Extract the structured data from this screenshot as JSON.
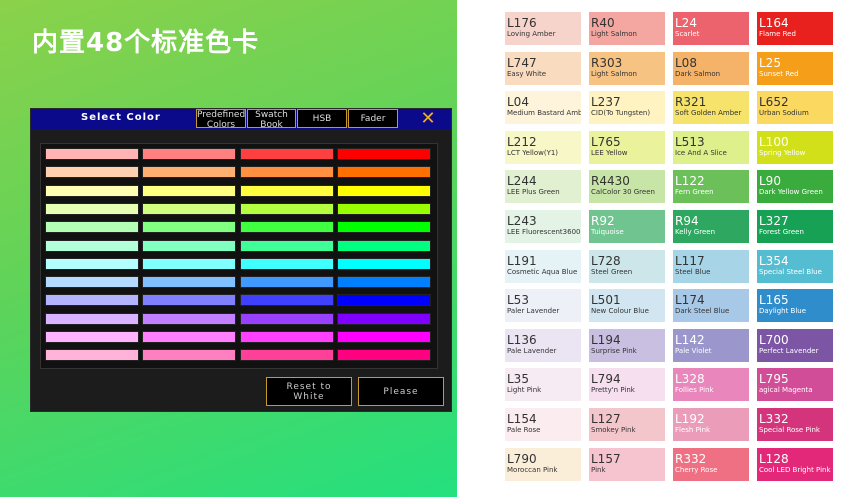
{
  "headline": "内置48个标准色卡",
  "dialog": {
    "title": "Select Color",
    "tabs": [
      {
        "lines": [
          "Predefined",
          "Colors"
        ],
        "active": true
      },
      {
        "lines": [
          "Swatch",
          "Book"
        ],
        "active": false
      },
      {
        "lines": [
          "HSB"
        ],
        "active": false
      },
      {
        "lines": [
          "Fader"
        ],
        "active": false
      }
    ],
    "close_glyph": "✕",
    "swatch_rows": [
      [
        "#ffb3b3",
        "#ff8080",
        "#ff4040",
        "#ff0000"
      ],
      [
        "#ffd0b0",
        "#ffb070",
        "#ff9040",
        "#ff7000"
      ],
      [
        "#ffffb3",
        "#ffff80",
        "#ffff40",
        "#ffff00"
      ],
      [
        "#e6ffb3",
        "#d0ff80",
        "#b3ff40",
        "#99ff00"
      ],
      [
        "#b3ffb3",
        "#80ff80",
        "#40ff40",
        "#00ff00"
      ],
      [
        "#b3ffd9",
        "#80ffc0",
        "#40ff99",
        "#00ff80"
      ],
      [
        "#b3ffff",
        "#80ffff",
        "#40ffff",
        "#00ffff"
      ],
      [
        "#b3d9ff",
        "#80c0ff",
        "#4099ff",
        "#0080ff"
      ],
      [
        "#b3b3ff",
        "#8080ff",
        "#4040ff",
        "#0000ff"
      ],
      [
        "#d9b3ff",
        "#c080ff",
        "#9940ff",
        "#8000ff"
      ],
      [
        "#ffb3ff",
        "#ff80ff",
        "#ff40ff",
        "#ff00ff"
      ],
      [
        "#ffb3d9",
        "#ff80c0",
        "#ff4099",
        "#ff0080"
      ]
    ],
    "buttons": {
      "reset": [
        "Reset to",
        "White"
      ],
      "please": "Please"
    }
  },
  "cards": [
    {
      "code": "L176",
      "name": "Loving Amber",
      "color": "#f6d4cc",
      "text": "#333333"
    },
    {
      "code": "R40",
      "name": "Light Salmon",
      "color": "#f3a7a0",
      "text": "#333333"
    },
    {
      "code": "L24",
      "name": "Scarlet",
      "color": "#ec636d",
      "text": "#ffffff"
    },
    {
      "code": "L164",
      "name": "Flame Red",
      "color": "#e8211f",
      "text": "#ffffff"
    },
    {
      "code": "L747",
      "name": "Easy White",
      "color": "#f9dbc0",
      "text": "#333333"
    },
    {
      "code": "R303",
      "name": "Light Salmon",
      "color": "#f7c383",
      "text": "#333333"
    },
    {
      "code": "L08",
      "name": "Dark Salmon",
      "color": "#f5b36a",
      "text": "#333333"
    },
    {
      "code": "L25",
      "name": "Sunset Red",
      "color": "#f49e1a",
      "text": "#ffffff"
    },
    {
      "code": "L04",
      "name": "Medium Bastard Amber",
      "color": "#fef4dc",
      "text": "#333333"
    },
    {
      "code": "L237",
      "name": "CID(To Tungsten)",
      "color": "#fff3c2",
      "text": "#333333"
    },
    {
      "code": "R321",
      "name": "Soft Golden Amber",
      "color": "#f5e36c",
      "text": "#333333"
    },
    {
      "code": "L652",
      "name": "Urban Sodium",
      "color": "#fbd960",
      "text": "#333333"
    },
    {
      "code": "L212",
      "name": "LCT Yellow(Y1)",
      "color": "#f7f7c8",
      "text": "#333333"
    },
    {
      "code": "L765",
      "name": "LEE Yellow",
      "color": "#ebf29c",
      "text": "#333333"
    },
    {
      "code": "L513",
      "name": "Ice And A Slice",
      "color": "#def08c",
      "text": "#333333"
    },
    {
      "code": "L100",
      "name": "Spring Yellow",
      "color": "#d2e01a",
      "text": "#ffffff"
    },
    {
      "code": "L244",
      "name": "LEE Plus Green",
      "color": "#e2f0d2",
      "text": "#333333"
    },
    {
      "code": "R4430",
      "name": "CalColor 30 Green",
      "color": "#c8e5a8",
      "text": "#333333"
    },
    {
      "code": "L122",
      "name": "Fern Green",
      "color": "#6cc05a",
      "text": "#ffffff"
    },
    {
      "code": "L90",
      "name": "Dark Yellow Green",
      "color": "#3aab3d",
      "text": "#ffffff"
    },
    {
      "code": "L243",
      "name": "LEE Fluorescent3600K",
      "color": "#e3f3e6",
      "text": "#333333"
    },
    {
      "code": "R92",
      "name": "Tuiquoise",
      "color": "#6fc490",
      "text": "#ffffff"
    },
    {
      "code": "R94",
      "name": "Kelly Green",
      "color": "#2ea861",
      "text": "#ffffff"
    },
    {
      "code": "L327",
      "name": "Forest Green",
      "color": "#17a155",
      "text": "#ffffff"
    },
    {
      "code": "L191",
      "name": "Cosmetic Aqua Blue",
      "color": "#e5f3f6",
      "text": "#333333"
    },
    {
      "code": "L728",
      "name": "Steel Green",
      "color": "#cde6ea",
      "text": "#333333"
    },
    {
      "code": "L117",
      "name": "Steel Blue",
      "color": "#a7d4e6",
      "text": "#333333"
    },
    {
      "code": "L354",
      "name": "Special Steel Blue",
      "color": "#55bdd2",
      "text": "#ffffff"
    },
    {
      "code": "L53",
      "name": "Paler Lavender",
      "color": "#eef0f8",
      "text": "#333333"
    },
    {
      "code": "L501",
      "name": "New Colour Blue",
      "color": "#d2e6f1",
      "text": "#333333"
    },
    {
      "code": "L174",
      "name": "Dark Steel Blue",
      "color": "#a7c8e6",
      "text": "#333333"
    },
    {
      "code": "L165",
      "name": "Daylight Blue",
      "color": "#2f8dcc",
      "text": "#ffffff"
    },
    {
      "code": "L136",
      "name": "Pale Lavender",
      "color": "#ebe5f3",
      "text": "#333333"
    },
    {
      "code": "L194",
      "name": "Surprise Pink",
      "color": "#c8bfe1",
      "text": "#333333"
    },
    {
      "code": "L142",
      "name": "Pale Violet",
      "color": "#9b96cc",
      "text": "#ffffff"
    },
    {
      "code": "L700",
      "name": "Perfect Lavender",
      "color": "#7c55a5",
      "text": "#ffffff"
    },
    {
      "code": "L35",
      "name": "Light Pink",
      "color": "#f6eaf3",
      "text": "#333333"
    },
    {
      "code": "L794",
      "name": "Pretty'n Pink",
      "color": "#f6dfee",
      "text": "#333333"
    },
    {
      "code": "L328",
      "name": "Follies Pink",
      "color": "#e986bc",
      "text": "#ffffff"
    },
    {
      "code": "L795",
      "name": "agical Magenta",
      "color": "#d24d98",
      "text": "#ffffff"
    },
    {
      "code": "L154",
      "name": "Pale Rose",
      "color": "#fbecf0",
      "text": "#333333"
    },
    {
      "code": "L127",
      "name": "Smokey Pink",
      "color": "#f3c6cc",
      "text": "#333333"
    },
    {
      "code": "L192",
      "name": "Flesh Pink",
      "color": "#ea9cb8",
      "text": "#ffffff"
    },
    {
      "code": "L332",
      "name": "Special Rose Pink",
      "color": "#d4347c",
      "text": "#ffffff"
    },
    {
      "code": "L790",
      "name": "Moroccan Pink",
      "color": "#fbeed9",
      "text": "#333333"
    },
    {
      "code": "L157",
      "name": "Pink",
      "color": "#f5c4cf",
      "text": "#333333"
    },
    {
      "code": "R332",
      "name": "Cherry Rose",
      "color": "#ef6f83",
      "text": "#ffffff"
    },
    {
      "code": "L128",
      "name": "Cool LED Bright Pink",
      "color": "#e3287a",
      "text": "#ffffff"
    }
  ]
}
